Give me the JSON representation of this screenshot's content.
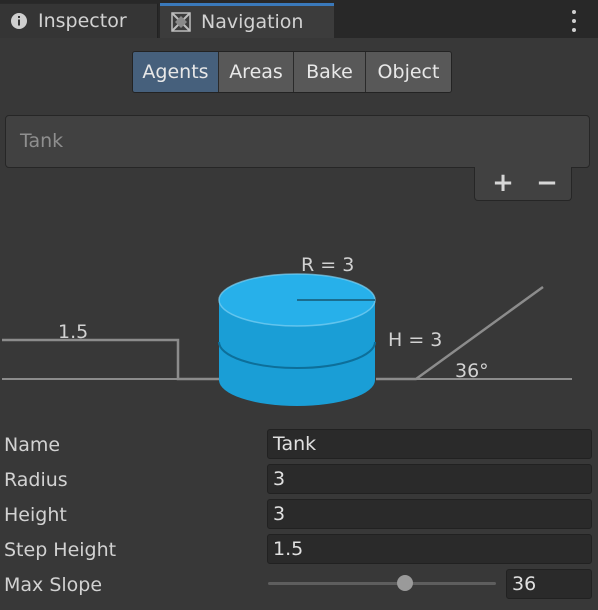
{
  "tabs": {
    "inspector": {
      "label": "Inspector",
      "icon": "info-icon"
    },
    "navigation": {
      "label": "Navigation",
      "icon": "navigation-icon"
    }
  },
  "toolbar": {
    "agents": "Agents",
    "areas": "Areas",
    "bake": "Bake",
    "object": "Object",
    "active": "Agents"
  },
  "agent_list": {
    "items": [
      "Tank"
    ],
    "add_label": "+",
    "remove_label": "−"
  },
  "diagram": {
    "radius_label": "R = 3",
    "height_label": "H = 3",
    "step_label": "1.5",
    "slope_label": "36°"
  },
  "properties": {
    "name": {
      "label": "Name",
      "value": "Tank"
    },
    "radius": {
      "label": "Radius",
      "value": "3"
    },
    "height": {
      "label": "Height",
      "value": "3"
    },
    "step_height": {
      "label": "Step Height",
      "value": "1.5"
    },
    "max_slope": {
      "label": "Max Slope",
      "value": "36",
      "slider_fraction": 0.6
    }
  },
  "colors": {
    "accent": "#3a79bb",
    "active_segment": "#46607c",
    "agent_cylinder": "#1a9ed6"
  }
}
